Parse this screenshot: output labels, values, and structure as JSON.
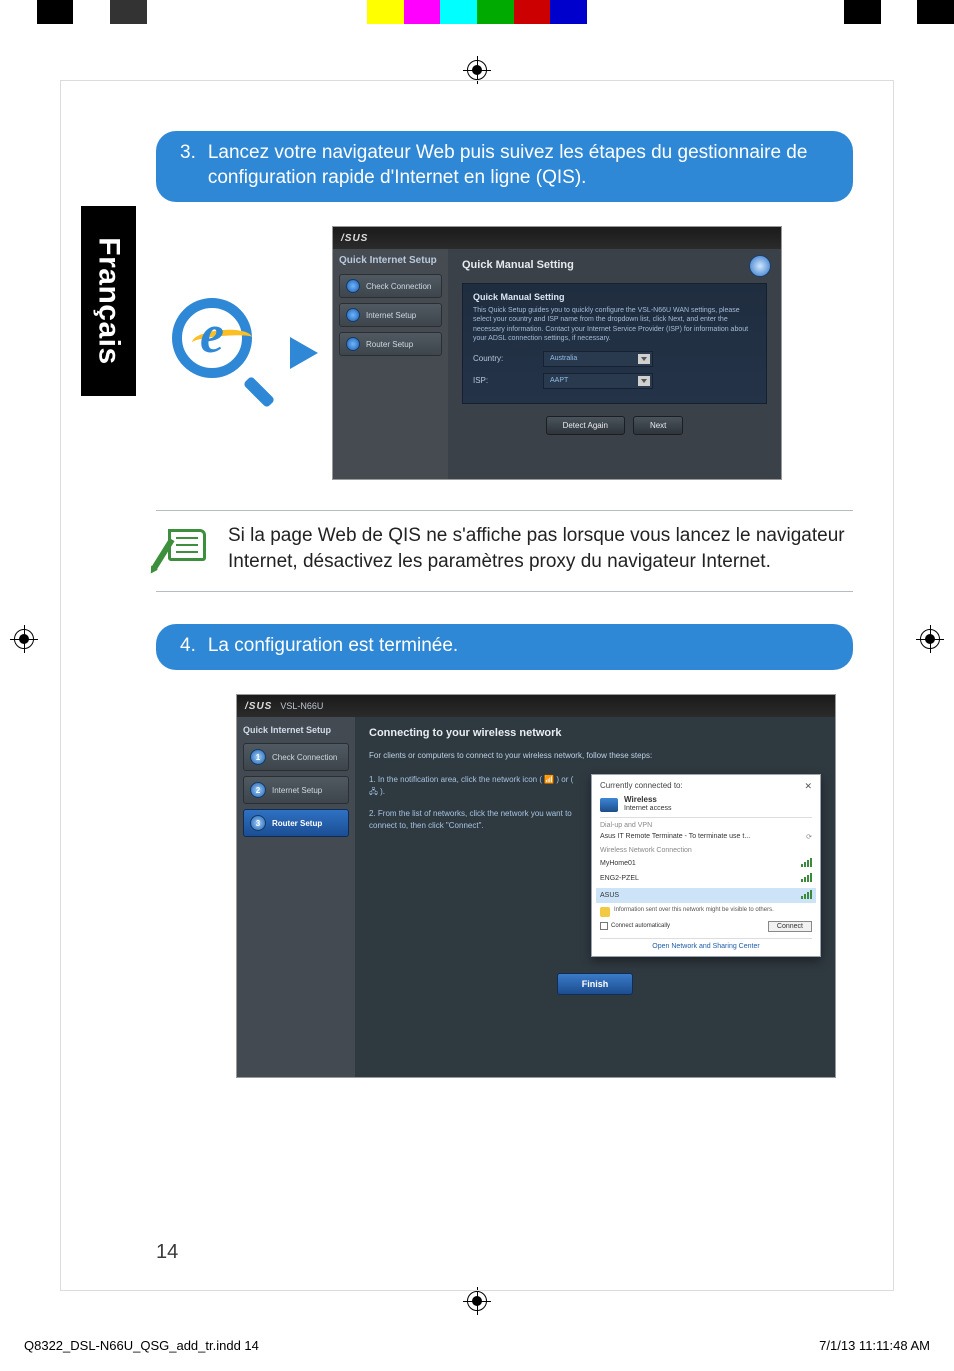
{
  "page_number": "14",
  "side_tab": "Français",
  "callout3": {
    "num": "3.",
    "text": "Lancez votre navigateur Web puis suivez les étapes du gestionnaire de configuration rapide d'Internet en ligne (QIS)."
  },
  "callout4": {
    "num": "4.",
    "text": "La configuration est terminée."
  },
  "note_text": "Si la page Web de QIS ne s'affiche pas lorsque vous lancez le navigateur Internet, désactivez les paramètres proxy du navigateur Internet.",
  "shot1": {
    "brand": "/SUS",
    "side_title": "Quick Internet Setup",
    "side_items": [
      "Check Connection",
      "Internet Setup",
      "Router Setup"
    ],
    "header": "Quick Manual Setting",
    "panel_title": "Quick Manual Setting",
    "panel_desc": "This Quick Setup guides you to quickly configure the VSL-N66U WAN settings, please select your country and ISP name from the dropdown list, click Next, and enter the necessary information. Contact your Internet Service Provider (ISP) for information about your ADSL connection settings, if necessary.",
    "row1_label": "Country:",
    "row1_value": "Australia",
    "row2_label": "ISP:",
    "row2_value": "AAPT",
    "btn1": "Detect Again",
    "btn2": "Next"
  },
  "shot2": {
    "brand": "/SUS",
    "model": "VSL-N66U",
    "side_title": "Quick Internet Setup",
    "side_items": [
      {
        "num": "1",
        "label": "Check Connection"
      },
      {
        "num": "2",
        "label": "Internet Setup"
      },
      {
        "num": "3",
        "label": "Router Setup"
      }
    ],
    "header": "Connecting to your wireless network",
    "intro": "For clients or computers to connect to your wireless network, follow these steps:",
    "step1": "1. In the notification area, click the network icon ( 📶 ) or ( 🖧 ).",
    "step2": "2. From the list of networks, click the network you want to connect to, then click \"Connect\".",
    "popup": {
      "top_title": "Currently connected to:",
      "close": "✕",
      "cur_name": "Wireless",
      "cur_sub": "Internet access",
      "cat1": "Dial-up and VPN",
      "net1": "Asus IT Remote Terminate - To terminate use t...",
      "cat2": "Wireless Network Connection",
      "net2": "MyHome01",
      "net3": "ENG2-PZEL",
      "net4": "ASUS",
      "warn": "Information sent over this network might be visible to others.",
      "auto": "Connect automatically",
      "connect": "Connect",
      "link": "Open Network and Sharing Center"
    },
    "finish": "Finish"
  },
  "footer": {
    "left": "Q8322_DSL-N66U_QSG_add_tr.indd   14",
    "right": "7/1/13   11:11:48 AM"
  }
}
